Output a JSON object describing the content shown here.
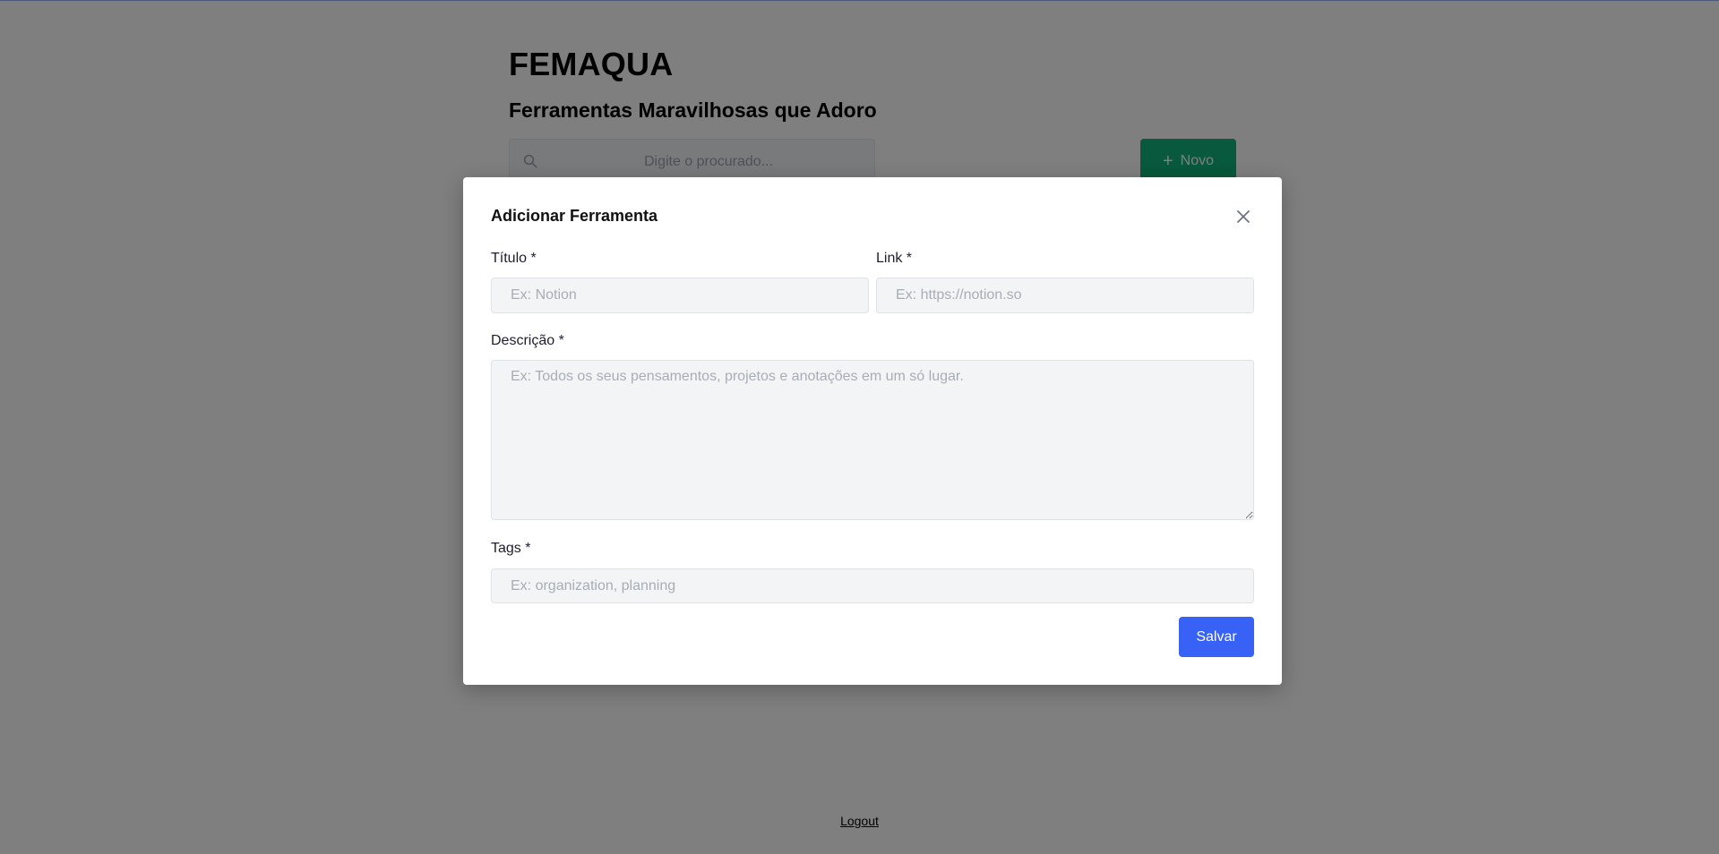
{
  "app": {
    "title": "FEMAQUA",
    "subtitle": "Ferramentas Maravilhosas que Adoro"
  },
  "search": {
    "placeholder": "Digite o procurado..."
  },
  "toolbar": {
    "new_label": "Novo"
  },
  "footer": {
    "logout_label": "Logout"
  },
  "modal": {
    "title": "Adicionar Ferramenta",
    "fields": {
      "title": {
        "label": "Título *",
        "placeholder": "Ex: Notion"
      },
      "link": {
        "label": "Link *",
        "placeholder": "Ex: https://notion.so"
      },
      "description": {
        "label": "Descrição *",
        "placeholder": "Ex: Todos os seus pensamentos, projetos e anotações em um só lugar."
      },
      "tags": {
        "label": "Tags *",
        "placeholder": "Ex: organization, planning"
      }
    },
    "save_label": "Salvar"
  },
  "colors": {
    "accent_blue": "#3861f6",
    "accent_green": "#10b27a",
    "overlay": "rgba(0,0,0,0.5)"
  },
  "icons": {
    "search": "search-icon",
    "plus": "plus-icon",
    "close": "close-icon"
  }
}
